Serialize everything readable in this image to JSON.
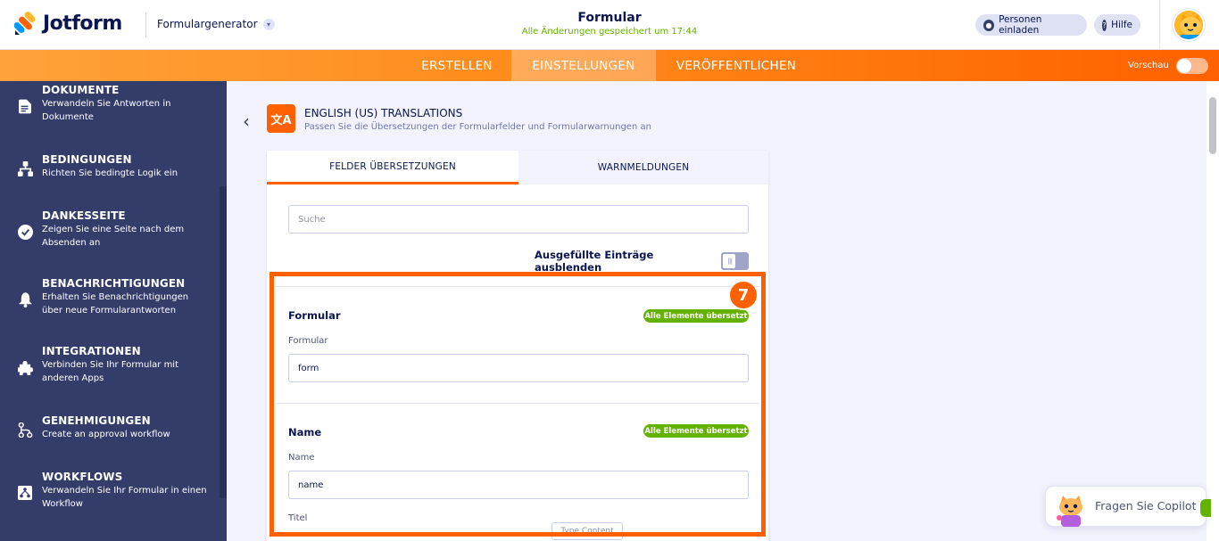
{
  "header": {
    "logo_text": "Jotform",
    "form_generator": "Formulargenerator",
    "form_title": "Formular",
    "save_status": "Alle Änderungen gespeichert um 17:44",
    "invite_label": "Personen einladen",
    "help_label": "Hilfe"
  },
  "nav": {
    "tabs": [
      {
        "label": "ERSTELLEN"
      },
      {
        "label": "EINSTELLUNGEN"
      },
      {
        "label": "VERÖFFENTLICHEN"
      }
    ],
    "preview_label": "Vorschau"
  },
  "sidebar": {
    "items": [
      {
        "title": "DOKUMENTE",
        "desc": "Verwandeln Sie Antworten in Dokumente",
        "icon": "document-icon"
      },
      {
        "title": "BEDINGUNGEN",
        "desc": "Richten Sie bedingte Logik ein",
        "icon": "conditions-icon"
      },
      {
        "title": "DANKESSEITE",
        "desc": "Zeigen Sie eine Seite nach dem Absenden an",
        "icon": "check-circle-icon"
      },
      {
        "title": "BENACHRICHTIGUNGEN",
        "desc": "Erhalten Sie Benachrichtigungen über neue Formularantworten",
        "icon": "bell-icon"
      },
      {
        "title": "INTEGRATIONEN",
        "desc": "Verbinden Sie Ihr Formular mit anderen Apps",
        "icon": "puzzle-icon"
      },
      {
        "title": "GENEHMIGUNGEN",
        "desc": "Create an approval workflow",
        "icon": "approval-icon"
      },
      {
        "title": "WORKFLOWS",
        "desc": "Verwandeln Sie Ihr Formular in einen Workflow",
        "icon": "workflow-icon"
      }
    ]
  },
  "translations": {
    "title": "ENGLISH (US) TRANSLATIONS",
    "subtitle": "Passen Sie die Übersetzungen der Formularfelder und Formularwarnungen an",
    "tabs": [
      {
        "label": "FELDER ÜBERSETZUNGEN"
      },
      {
        "label": "WARNMELDUNGEN"
      }
    ],
    "search_placeholder": "Suche",
    "hide_filled_label": "Ausgefüllte Einträge ausblenden",
    "step_number": "7",
    "sections": [
      {
        "title": "Formular",
        "badge": "Alle Elemente übersetzt",
        "field_label": "Formular",
        "field_value": "form"
      },
      {
        "title": "Name",
        "badge": "Alle Elemente übersetzt",
        "field_label": "Name",
        "field_value": "name",
        "extra_label": "Titel",
        "ghost_placeholder": "Type Content"
      }
    ]
  },
  "copilot": {
    "label": "Fragen Sie Copilot"
  },
  "colors": {
    "accent": "#ff6100",
    "navy": "#0a1551",
    "sidebar": "#343c6a",
    "success": "#64b200"
  }
}
